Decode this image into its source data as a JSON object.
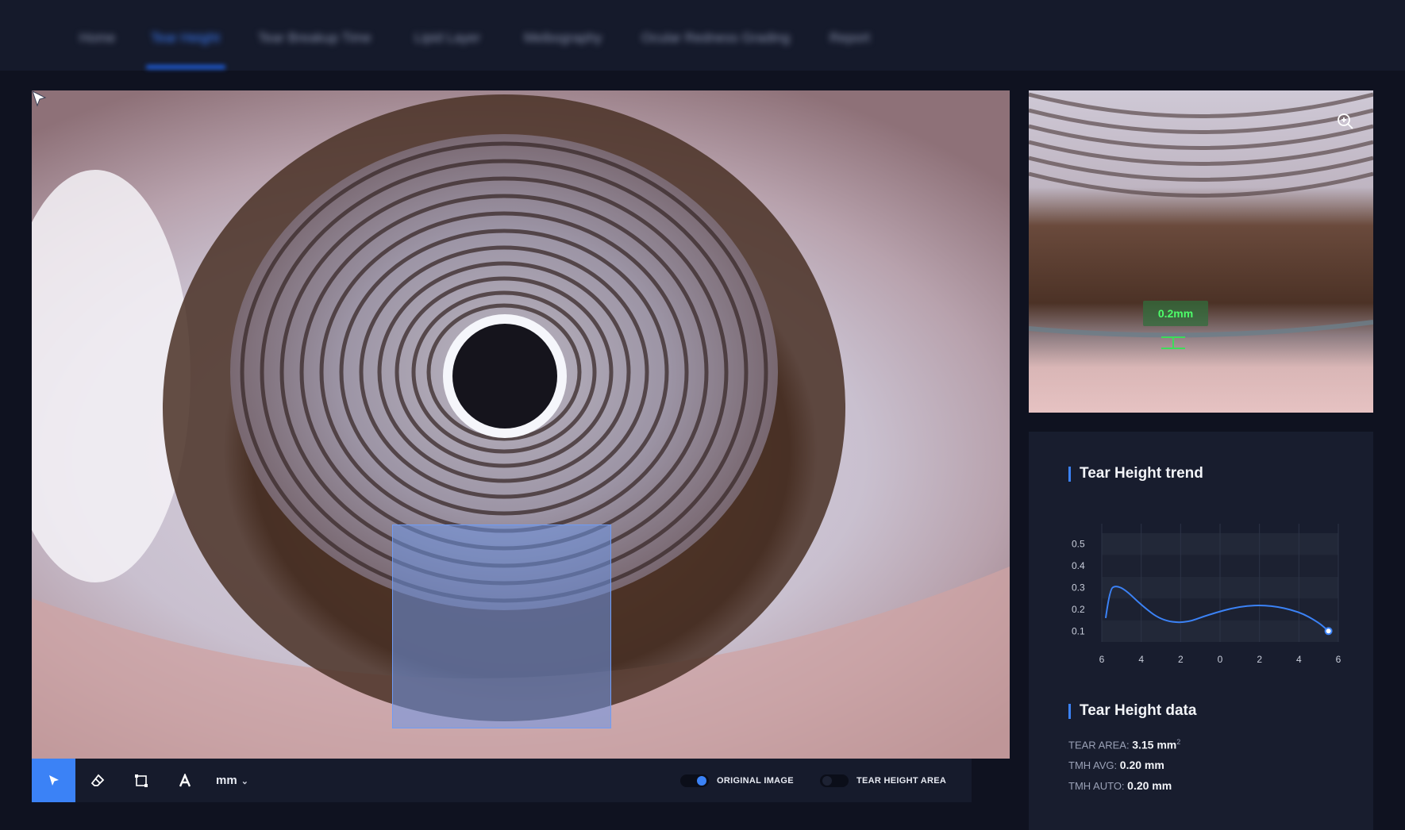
{
  "nav": {
    "items": [
      {
        "label": "Home"
      },
      {
        "label": "Tear Height"
      },
      {
        "label": "Tear Breakup Time"
      },
      {
        "label": "Lipid Layer"
      },
      {
        "label": "Meibography"
      },
      {
        "label": "Ocular Redness Grading"
      },
      {
        "label": "Report"
      }
    ],
    "active_index": 1
  },
  "toolbar": {
    "tools": [
      "select-icon",
      "eraser-icon",
      "rectangle-icon",
      "text-icon"
    ],
    "unit_label": "mm",
    "toggles": [
      {
        "label": "ORIGINAL IMAGE",
        "on": true
      },
      {
        "label": "TEAR HEIGHT AREA",
        "on": false
      }
    ]
  },
  "zoom": {
    "measurement": "0.2mm"
  },
  "trend": {
    "title": "Tear Height trend"
  },
  "chart_data": {
    "type": "line",
    "x_ticks": [
      "6",
      "4",
      "2",
      "0",
      "2",
      "4",
      "6"
    ],
    "y_ticks": [
      "0.1",
      "0.2",
      "0.3",
      "0.4",
      "0.5"
    ],
    "x": [
      -5.8,
      -5.6,
      -5.3,
      -4.8,
      -4.0,
      -3.0,
      -1.8,
      -0.6,
      1.0,
      2.5,
      4.0,
      5.0,
      5.5
    ],
    "y": [
      0.16,
      0.29,
      0.31,
      0.29,
      0.22,
      0.15,
      0.135,
      0.175,
      0.215,
      0.22,
      0.19,
      0.14,
      0.1
    ],
    "ylim": [
      0.05,
      0.55
    ],
    "xlim": [
      -6,
      6
    ],
    "grid": true,
    "color": "#3b82f6"
  },
  "data_section": {
    "title": "Tear Height data",
    "rows": [
      {
        "label": "TEAR AREA:",
        "value": "3.15 mm",
        "sup": "2"
      },
      {
        "label": "TMH AVG:",
        "value": "0.20 mm",
        "sup": ""
      },
      {
        "label": "TMH AUTO:",
        "value": "0.20 mm",
        "sup": ""
      }
    ]
  }
}
